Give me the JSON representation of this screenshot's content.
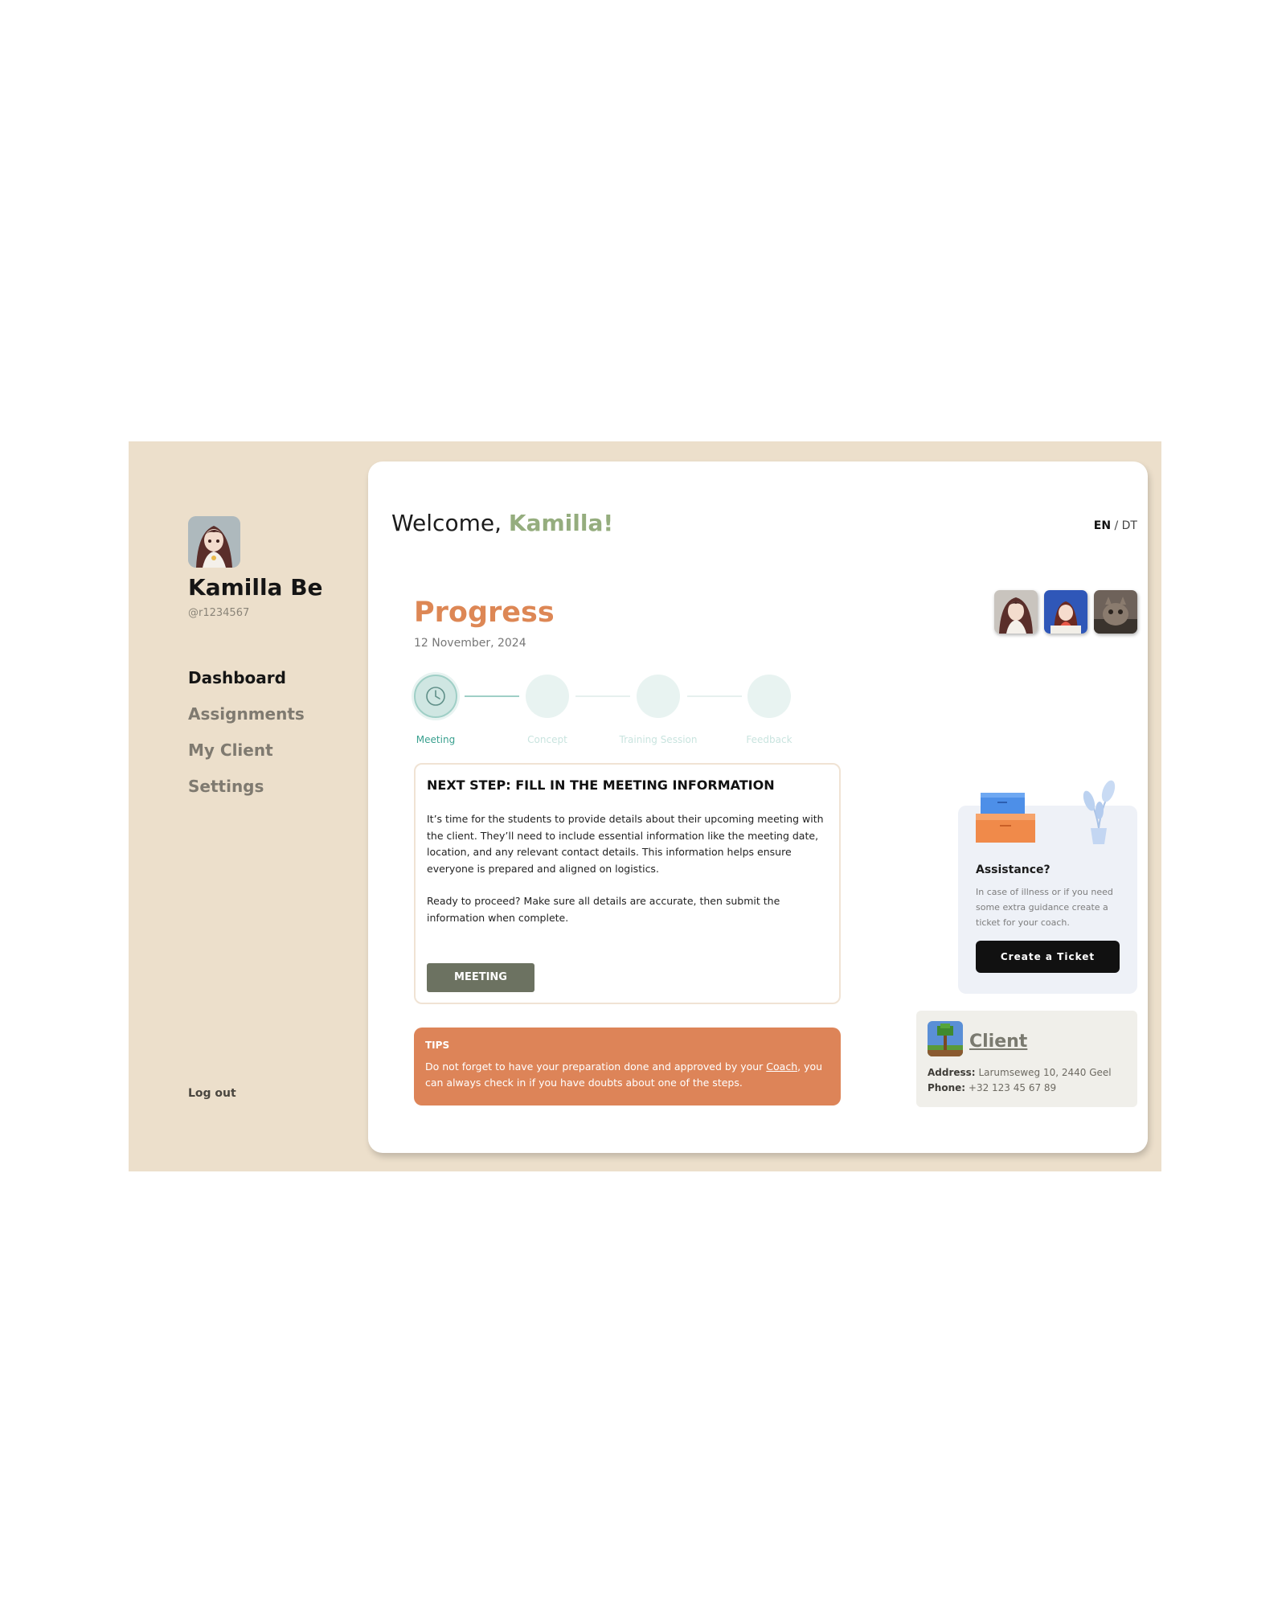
{
  "user": {
    "name": "Kamilla Be",
    "handle": "@r1234567"
  },
  "nav": {
    "items": [
      {
        "label": "Dashboard",
        "active": true
      },
      {
        "label": "Assignments",
        "active": false
      },
      {
        "label": "My Client",
        "active": false
      },
      {
        "label": "Settings",
        "active": false
      }
    ],
    "logout": "Log out"
  },
  "header": {
    "welcome": "Welcome,",
    "name": "Kamilla!",
    "lang_active": "EN",
    "lang_sep": "/",
    "lang_other": "DT"
  },
  "progress": {
    "title": "Progress",
    "date": "12 November, 2024",
    "steps": [
      {
        "label": "Meeting",
        "status": "current"
      },
      {
        "label": "Concept",
        "status": "pending"
      },
      {
        "label": "Training Session",
        "status": "pending"
      },
      {
        "label": "Feedback",
        "status": "pending"
      }
    ]
  },
  "next_step": {
    "title": "NEXT STEP: FILL IN THE MEETING INFORMATION",
    "paragraph1": "It’s time for the students to provide details about their upcoming meeting with the client. They’ll need to include essential information like the meeting date, location, and any relevant contact details. This information helps ensure everyone is prepared and aligned on logistics.",
    "paragraph2": "Ready to proceed? Make sure all details are accurate, then submit the information when complete.",
    "button": "MEETING"
  },
  "tips": {
    "title": "TIPS",
    "text_before": "Do not forget to have your preparation done and approved by your ",
    "link": "Coach",
    "text_after": ", you can always check in if you have doubts about one of the steps."
  },
  "assistance": {
    "title": "Assistance?",
    "text": "In case of illness or if you need some extra guidance create a ticket for your coach.",
    "button": "Create a Ticket"
  },
  "client": {
    "title": "Client",
    "address_label": "Address:",
    "address": "Larumseweg 10, 2440 Geel",
    "phone_label": "Phone:",
    "phone": "+32 123 45 67 89"
  },
  "colors": {
    "frame": "#ecdfcb",
    "accent_green": "#95ad7e",
    "progress_orange": "#dd8755",
    "teal": "#3aa08f",
    "tips_bg": "#dd8458",
    "button_olive": "#6c7261"
  }
}
